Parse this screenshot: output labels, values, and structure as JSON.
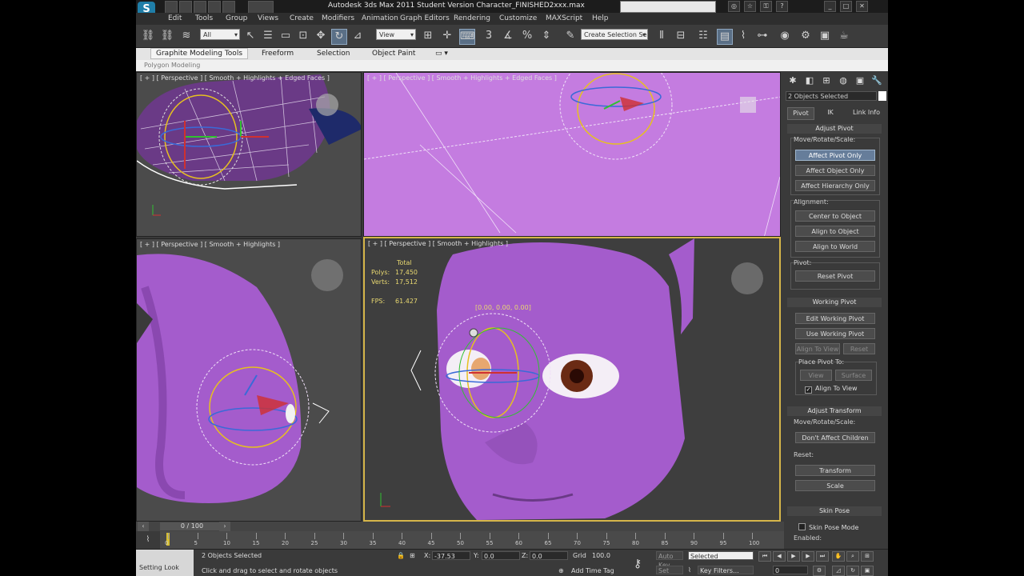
{
  "title_bar": {
    "app_title": "Autodesk 3ds Max 2011    Student Version    Character_FINISHED2xxx.max"
  },
  "menu": [
    "Edit",
    "Tools",
    "Group",
    "Views",
    "Create",
    "Modifiers",
    "Animation",
    "Graph Editors",
    "Rendering",
    "Customize",
    "MAXScript",
    "Help"
  ],
  "toolbar": {
    "filter_select": "All",
    "ref_coord_select": "View",
    "named_selection_set": "Create Selection Se"
  },
  "ribbon": {
    "tabs": [
      "Graphite Modeling Tools",
      "Freeform",
      "Selection",
      "Object Paint"
    ],
    "sub_label": "Polygon Modeling"
  },
  "viewports": {
    "top_left_label": "[ + ] [ Perspective ] [ Smooth + Highlights + Edged Faces ]",
    "top_right_label": "[ + ] [ Perspective ] [ Smooth + Highlights + Edged Faces ]",
    "bottom_left_label": "[ + ] [ Perspective ] [ Smooth + Highlights ]",
    "bottom_right_label": "[ + ] [ Perspective ] [ Smooth + Highlights ]",
    "stats_total": "Total",
    "stats_polys_label": "Polys:",
    "stats_polys_value": "17,450",
    "stats_verts_label": "Verts:",
    "stats_verts_value": "17,512",
    "stats_fps_label": "FPS:",
    "stats_fps_value": "61.427",
    "rotate_readout": "[0.00, 0.00, 0.00]"
  },
  "command_panel": {
    "selection_info": "2 Objects Selected",
    "tabs": [
      "Pivot",
      "IK",
      "Link Info"
    ],
    "adjust_pivot_header": "Adjust Pivot",
    "move_rotate_scale_label": "Move/Rotate/Scale:",
    "affect_pivot_only": "Affect Pivot Only",
    "affect_object_only": "Affect Object Only",
    "affect_hierarchy_only": "Affect Hierarchy Only",
    "alignment_label": "Alignment:",
    "center_to_object": "Center to Object",
    "align_to_object": "Align to Object",
    "align_to_world": "Align to World",
    "pivot_label": "Pivot:",
    "reset_pivot": "Reset Pivot",
    "working_pivot_header": "Working Pivot",
    "edit_working_pivot": "Edit Working Pivot",
    "use_working_pivot": "Use Working Pivot",
    "align_to_view": "Align To View",
    "reset": "Reset",
    "place_pivot_to_label": "Place Pivot To:",
    "view_btn": "View",
    "surface_btn": "Surface",
    "align_to_view_checkbox": "Align To View",
    "adjust_transform_header": "Adjust Transform",
    "move_rotate_scale_label2": "Move/Rotate/Scale:",
    "dont_affect_children": "Don't Affect Children",
    "reset_label": "Reset:",
    "transform_btn": "Transform",
    "scale_btn": "Scale",
    "skin_pose_header": "Skin Pose",
    "skin_pose_mode": "Skin Pose Mode",
    "enabled_label": "Enabled:"
  },
  "timeline": {
    "frames": "0 / 100",
    "ticks": [
      "0",
      "5",
      "10",
      "15",
      "20",
      "25",
      "30",
      "35",
      "40",
      "45",
      "50",
      "55",
      "60",
      "65",
      "70",
      "75",
      "80",
      "85",
      "90",
      "95",
      "100"
    ]
  },
  "status": {
    "maxscript": "Setting Look",
    "objects_selected": "2 Objects Selected",
    "prompt": "Click and drag to select and rotate objects",
    "x_label": "X:",
    "x_value": "-37.53",
    "y_label": "Y:",
    "y_value": "0.0",
    "z_label": "Z:",
    "z_value": "0.0",
    "grid_label": "Grid",
    "grid_value": "100.0",
    "add_time_tag": "Add Time Tag",
    "auto_key": "Auto Key",
    "set_key": "Set Key",
    "selected": "Selected",
    "key_filters": "Key Filters...",
    "current_frame": "0"
  },
  "colors": {
    "viewport_bg": "#b26bd0",
    "skin": "#a45ccc",
    "active_border": "#d6b64a",
    "selected_btn": "#667d9a"
  }
}
